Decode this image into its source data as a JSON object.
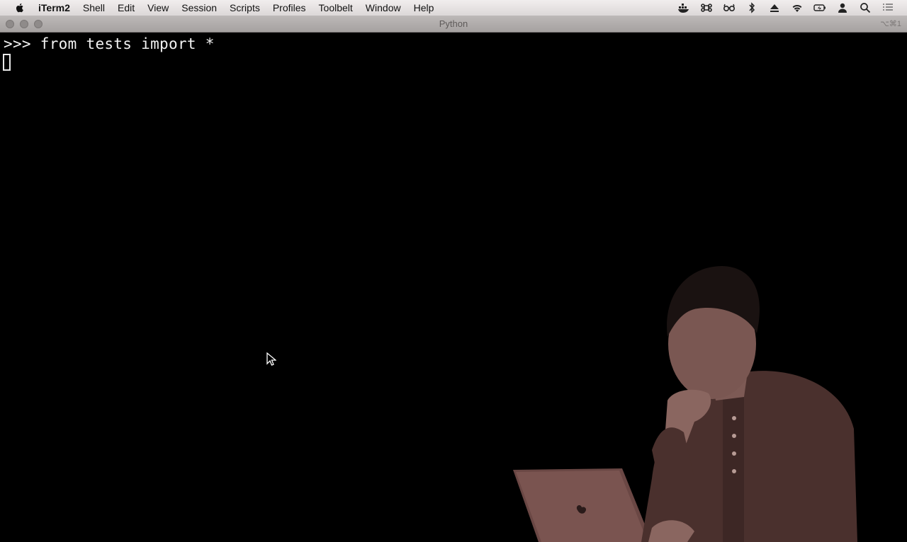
{
  "menubar": {
    "app_name": "iTerm2",
    "items": [
      "Shell",
      "Edit",
      "View",
      "Session",
      "Scripts",
      "Profiles",
      "Toolbelt",
      "Window",
      "Help"
    ]
  },
  "status_icons": [
    "docker-icon",
    "command-icon",
    "glasses-icon",
    "bluetooth-icon",
    "eject-icon",
    "wifi-icon",
    "battery-icon",
    "user-icon",
    "search-icon",
    "list-icon"
  ],
  "window": {
    "title": "Python",
    "shortcut": "⌥⌘1"
  },
  "terminal": {
    "prompt": ">>>",
    "command": "from tests import *"
  },
  "colors": {
    "terminal_bg": "#000000",
    "terminal_text": "#f2f2f2",
    "menubar_bg": "#e6e3e3",
    "presenter_tint": "#5a3d3a"
  }
}
